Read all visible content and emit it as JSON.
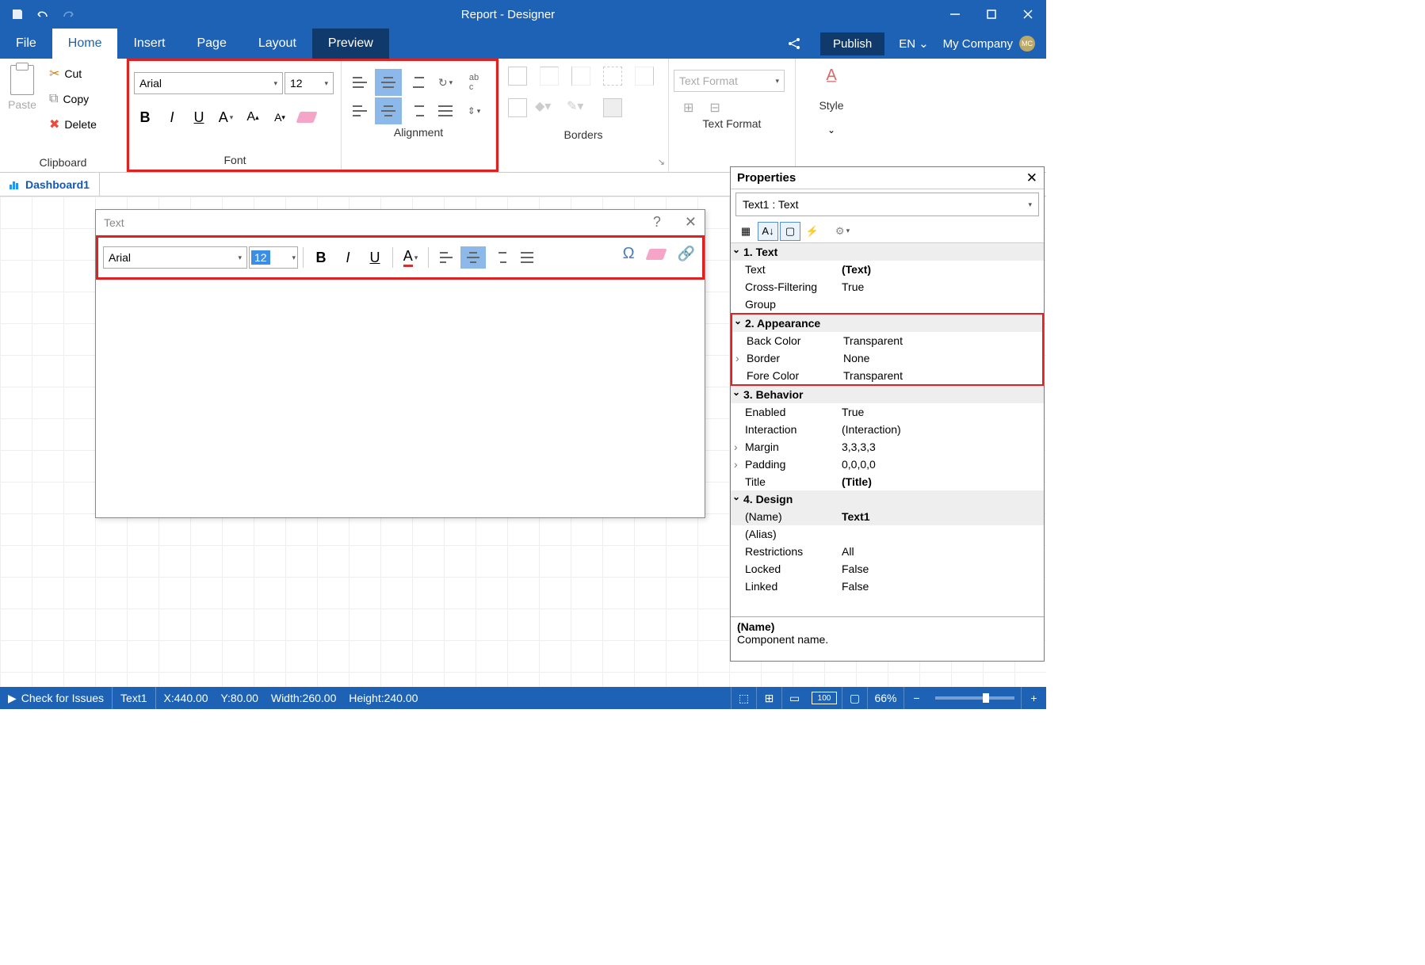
{
  "title": "Report - Designer",
  "menu": {
    "file": "File",
    "home": "Home",
    "insert": "Insert",
    "page": "Page",
    "layout": "Layout",
    "preview": "Preview",
    "publish": "Publish",
    "lang": "EN",
    "company": "My Company",
    "avatar": "MC"
  },
  "ribbon": {
    "clipboard": {
      "label": "Clipboard",
      "paste": "Paste",
      "cut": "Cut",
      "copy": "Copy",
      "delete": "Delete"
    },
    "font": {
      "label": "Font",
      "name": "Arial",
      "size": "12"
    },
    "alignment": {
      "label": "Alignment"
    },
    "borders": {
      "label": "Borders"
    },
    "textformat": {
      "label": "Text Format",
      "select": "Text Format"
    },
    "style": {
      "label": "Style"
    }
  },
  "doctab": "Dashboard1",
  "dialog": {
    "title": "Text",
    "font_name": "Arial",
    "font_size": "12"
  },
  "properties": {
    "title": "Properties",
    "object": "Text1 : Text",
    "desc_name": "(Name)",
    "desc_text": "Component name.",
    "cats": {
      "c1": "1. Text",
      "c2": "2. Appearance",
      "c3": "3. Behavior",
      "c4": "4. Design"
    },
    "rows": {
      "text_k": "Text",
      "text_v": "(Text)",
      "cf_k": "Cross-Filtering",
      "cf_v": "True",
      "grp_k": "Group",
      "grp_v": "",
      "bc_k": "Back Color",
      "bc_v": "Transparent",
      "bd_k": "Border",
      "bd_v": "None",
      "fc_k": "Fore Color",
      "fc_v": "Transparent",
      "en_k": "Enabled",
      "en_v": "True",
      "ia_k": "Interaction",
      "ia_v": "(Interaction)",
      "mg_k": "Margin",
      "mg_v": "3,3,3,3",
      "pd_k": "Padding",
      "pd_v": "0,0,0,0",
      "ti_k": "Title",
      "ti_v": "(Title)",
      "nm_k": "(Name)",
      "nm_v": "Text1",
      "al_k": "(Alias)",
      "al_v": "",
      "rs_k": "Restrictions",
      "rs_v": "All",
      "lk_k": "Locked",
      "lk_v": "False",
      "ln_k": "Linked",
      "ln_v": "False"
    }
  },
  "status": {
    "check": "Check for Issues",
    "obj": "Text1",
    "x": "X:440.00",
    "y": "Y:80.00",
    "w": "Width:260.00",
    "h": "Height:240.00",
    "zoom": "66%"
  }
}
